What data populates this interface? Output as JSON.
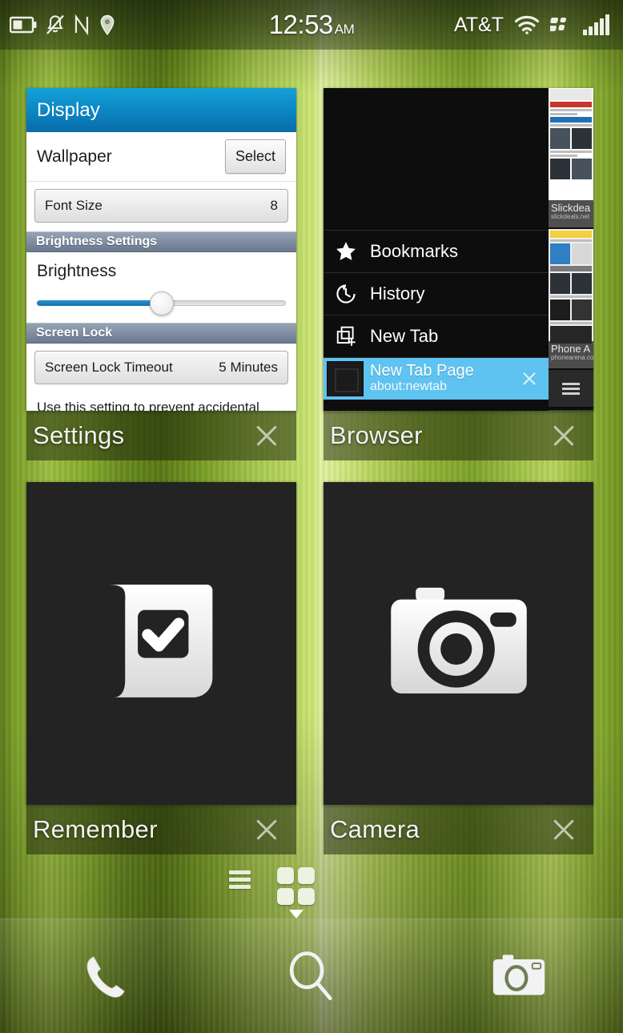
{
  "statusbar": {
    "time": "12:53",
    "ampm": "AM",
    "carrier": "AT&T",
    "icons": [
      "battery-icon",
      "mute-bell-icon",
      "nfc-icon",
      "location-pin-icon",
      "wifi-icon",
      "blackberry-logo-icon",
      "signal-bars-icon"
    ]
  },
  "cards": [
    {
      "id": "settings",
      "label": "Settings",
      "close_label": "×",
      "settings": {
        "header_title": "Display",
        "wallpaper_label": "Wallpaper",
        "select_button": "Select",
        "font_size_label": "Font Size",
        "font_size_value": "8",
        "brightness_section": "Brightness Settings",
        "brightness_label": "Brightness",
        "brightness_value": 50,
        "screen_lock_section": "Screen Lock",
        "screen_lock_label": "Screen Lock Timeout",
        "screen_lock_value": "5 Minutes",
        "help_text": "Use this setting to prevent accidental taps and presses. To unlock the device, swipe up from below"
      }
    },
    {
      "id": "browser",
      "label": "Browser",
      "close_label": "×",
      "browser": {
        "menu": [
          {
            "icon": "star-icon",
            "label": "Bookmarks"
          },
          {
            "icon": "history-icon",
            "label": "History"
          },
          {
            "icon": "new-tab-icon",
            "label": "New Tab"
          }
        ],
        "active_tab": {
          "title": "New Tab Page",
          "url": "about:newtab",
          "close_label": "×"
        },
        "thumbnails": [
          {
            "caption": "Slickdea",
            "sub": "slickdeals.net"
          },
          {
            "caption": "Phone A",
            "sub": "phonearena.com"
          }
        ],
        "menu_icon": "hamburger-icon"
      }
    },
    {
      "id": "remember",
      "label": "Remember",
      "close_label": "×",
      "app_icon": "remember-checkmark-icon"
    },
    {
      "id": "camera",
      "label": "Camera",
      "close_label": "×",
      "app_icon": "camera-icon"
    }
  ],
  "pager": {
    "items": [
      {
        "type": "messages-icon",
        "active": false
      },
      {
        "type": "active-frames-grid-icon",
        "active": true
      },
      {
        "type": "page-dot",
        "active": false
      },
      {
        "type": "page-dot",
        "active": false
      },
      {
        "type": "page-dot",
        "active": false
      }
    ]
  },
  "dock": {
    "items": [
      {
        "icon": "phone-icon",
        "label": "Phone"
      },
      {
        "icon": "search-icon",
        "label": "Search"
      },
      {
        "icon": "camera-icon",
        "label": "Camera"
      }
    ]
  },
  "colors": {
    "accent_blue": "#0b84c2",
    "tab_highlight": "#5ec3f0",
    "section_header": "#6a7991",
    "card_dark": "#232323",
    "wallpaper_green": "#8bb33a"
  }
}
